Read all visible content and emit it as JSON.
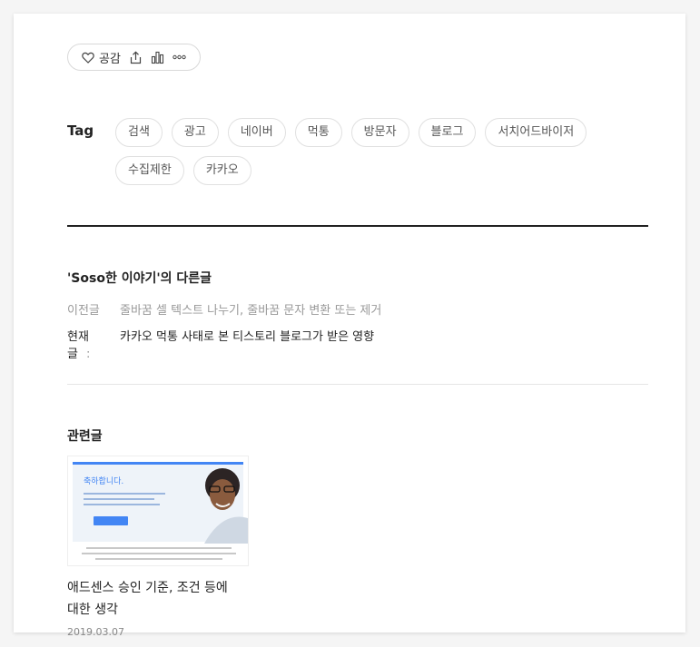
{
  "actions": {
    "like_label": "공감"
  },
  "tags": {
    "heading": "Tag",
    "items": [
      "검색",
      "광고",
      "네이버",
      "먹통",
      "방문자",
      "블로그",
      "서치어드바이저",
      "수집제한",
      "카카오"
    ]
  },
  "other_posts": {
    "title": "'Soso한 이야기'의 다른글",
    "prev_label": "이전글",
    "prev_sep": "",
    "prev_title": "줄바꿈 셀 텍스트 나누기, 줄바꿈 문자 변환 또는 제거",
    "current_label": "현재글",
    "current_sep": ":",
    "current_title": "카카오 먹통 사태로 본 티스토리 블로그가 받은 영향"
  },
  "related": {
    "title": "관련글",
    "items": [
      {
        "thumb_heading": "축하합니다.",
        "title": "애드센스 승인 기준, 조건 등에 대한 생각",
        "date": "2019.03.07"
      }
    ]
  },
  "colors": {
    "accent_blue": "#4285f4",
    "divider_dark": "#222222",
    "muted_text": "#999999"
  },
  "icons": [
    "heart-icon",
    "share-icon",
    "stats-icon",
    "more-icon"
  ]
}
